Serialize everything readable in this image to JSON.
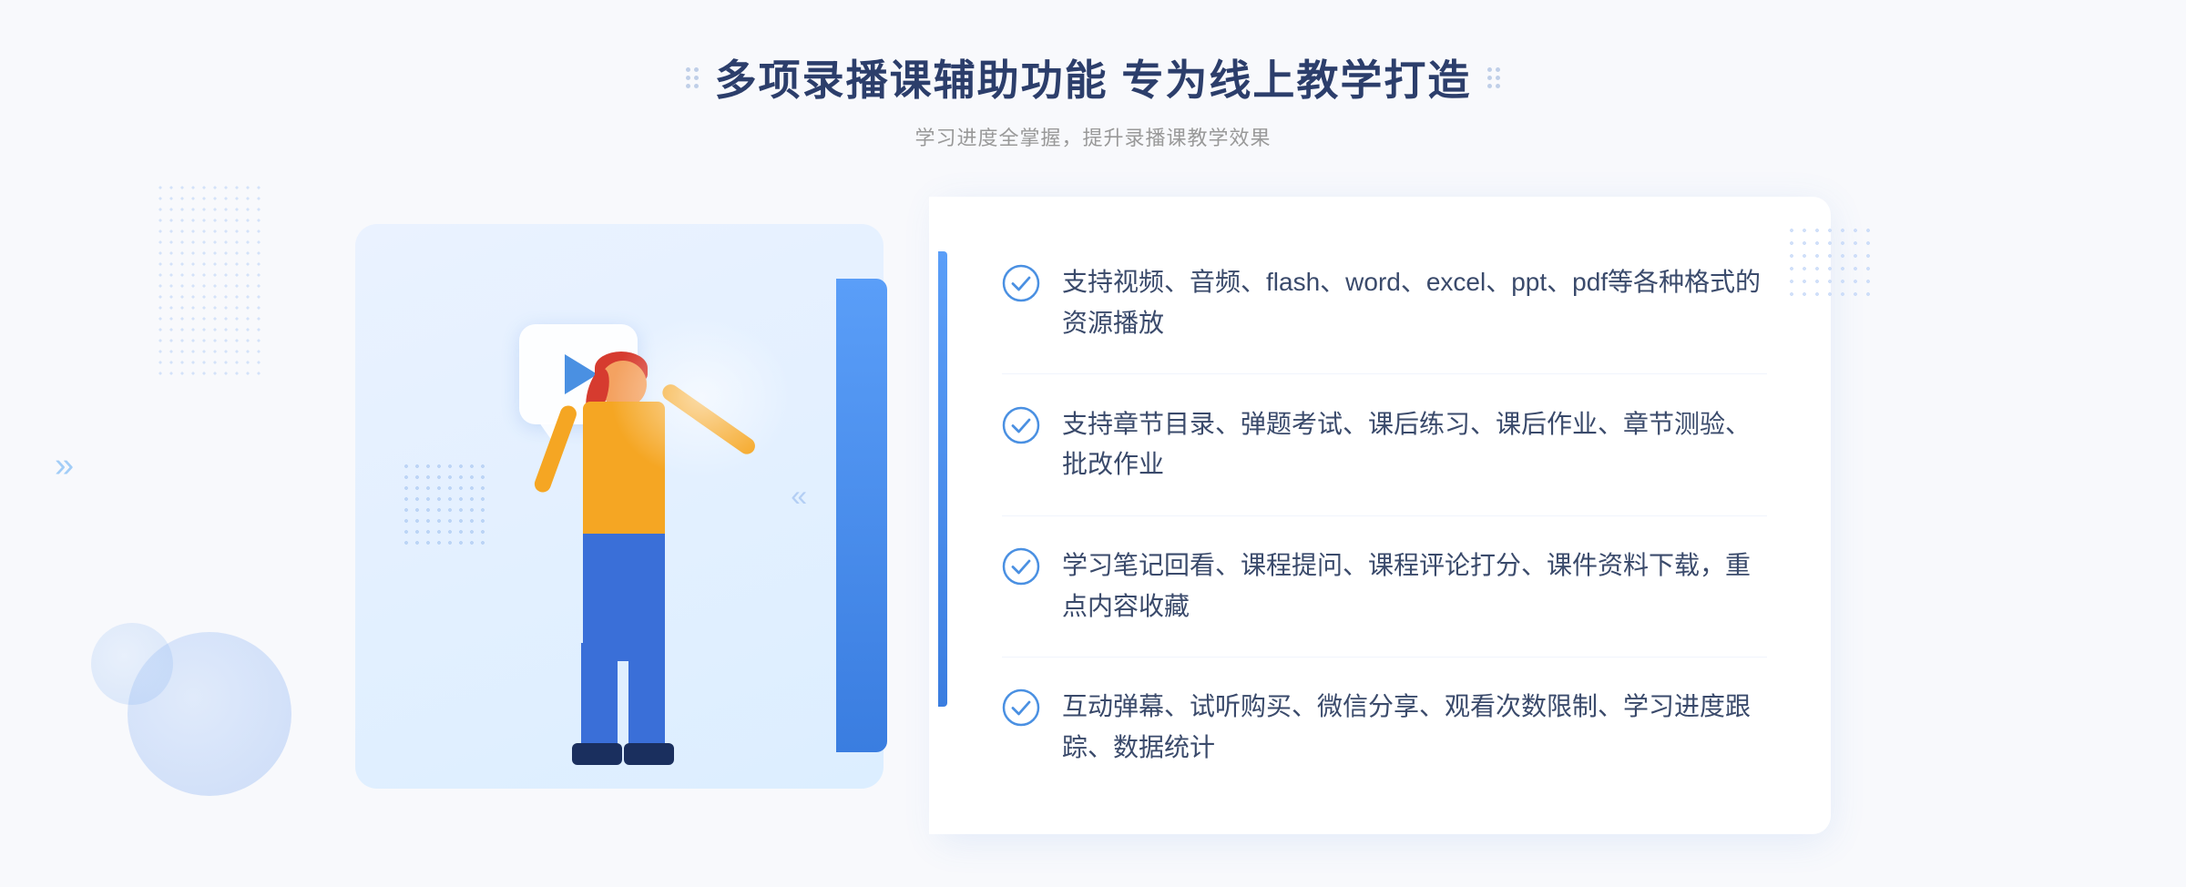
{
  "header": {
    "title": "多项录播课辅助功能 专为线上教学打造",
    "subtitle": "学习进度全掌握，提升录播课教学效果"
  },
  "features": [
    {
      "id": 1,
      "text": "支持视频、音频、flash、word、excel、ppt、pdf等各种格式的资源播放"
    },
    {
      "id": 2,
      "text": "支持章节目录、弹题考试、课后练习、课后作业、章节测验、批改作业"
    },
    {
      "id": 3,
      "text": "学习笔记回看、课程提问、课程评论打分、课件资料下载，重点内容收藏"
    },
    {
      "id": 4,
      "text": "互动弹幕、试听购买、微信分享、观看次数限制、学习进度跟踪、数据统计"
    }
  ],
  "decoration": {
    "chevron": "»",
    "checkIconColor": "#4a90e2"
  }
}
